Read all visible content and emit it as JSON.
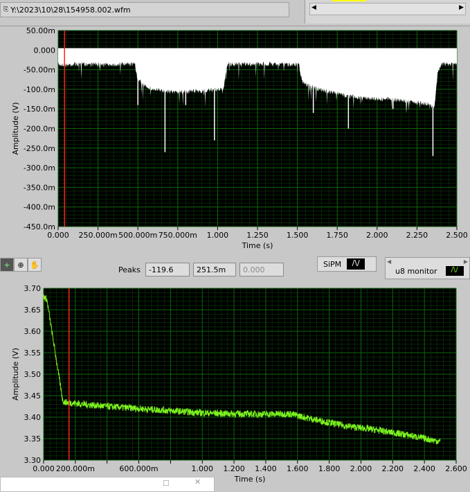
{
  "file_path": "Y:\\2023\\10\\28\\154958.002.wfm",
  "toolbar": {
    "peaks_label": "Peaks",
    "peak_values": [
      "-119.6",
      "251.5m",
      "0.000"
    ],
    "legend_sipm": "SiPM",
    "legend_u8": "u8 monitor"
  },
  "colors": {
    "plot_bg": "#000000",
    "grid": "#0a6a0a",
    "top_trace": "#ffffff",
    "bottom_trace": "#7cf21e",
    "cursor": "#ff2020"
  },
  "chart_data": [
    {
      "type": "area",
      "title": "",
      "xlabel": "Time (s)",
      "ylabel": "Amplitude (V)",
      "xlim": [
        0,
        2.5
      ],
      "ylim": [
        -0.45,
        0.05
      ],
      "xticks": [
        "0.000",
        "250.000m",
        "500.000m",
        "750.000m",
        "1.000",
        "1.250",
        "1.500",
        "1.750",
        "2.000",
        "2.250",
        "2.500"
      ],
      "yticks": [
        "50.00m",
        "0.000",
        "-50.00m",
        "-100.0m",
        "-150.0m",
        "-200.0m",
        "-250.0m",
        "-300.0m",
        "-350.0m",
        "-400.0m",
        "-450.0m"
      ],
      "cursor_x": 0.04,
      "series": [
        {
          "name": "SiPM",
          "fill_to": 0,
          "x": [
            0,
            0.05,
            0.1,
            0.2,
            0.3,
            0.4,
            0.48,
            0.5,
            0.55,
            0.6,
            0.7,
            0.8,
            0.9,
            1.0,
            1.04,
            1.06,
            1.2,
            1.4,
            1.51,
            1.53,
            1.6,
            1.7,
            1.8,
            1.9,
            2.0,
            2.1,
            2.2,
            2.3,
            2.36,
            2.38,
            2.4,
            2.5
          ],
          "y": [
            -0.03,
            -0.032,
            -0.03,
            -0.03,
            -0.031,
            -0.03,
            -0.03,
            -0.07,
            -0.085,
            -0.095,
            -0.1,
            -0.1,
            -0.098,
            -0.095,
            -0.09,
            -0.03,
            -0.03,
            -0.03,
            -0.03,
            -0.075,
            -0.09,
            -0.1,
            -0.11,
            -0.115,
            -0.118,
            -0.12,
            -0.125,
            -0.13,
            -0.14,
            -0.05,
            -0.03,
            -0.03
          ],
          "spikes": [
            [
              0.5,
              -0.14
            ],
            [
              0.67,
              -0.26
            ],
            [
              0.8,
              -0.14
            ],
            [
              0.98,
              -0.23
            ],
            [
              1.6,
              -0.16
            ],
            [
              1.82,
              -0.2
            ],
            [
              2.1,
              -0.15
            ],
            [
              2.35,
              -0.27
            ]
          ]
        }
      ]
    },
    {
      "type": "line",
      "title": "",
      "xlabel": "Time (s)",
      "ylabel": "Amplitude (V)",
      "xlim": [
        0,
        2.6
      ],
      "ylim": [
        3.3,
        3.7
      ],
      "xticks": [
        "0.000",
        "200.000m",
        "",
        "600.000m",
        "",
        "1.000",
        "1.200",
        "1.400",
        "1.600",
        "1.800",
        "2.000",
        "2.200",
        "2.400",
        "2.600"
      ],
      "yticks": [
        "3.70",
        "3.65",
        "3.60",
        "3.55",
        "3.50",
        "3.45",
        "3.40",
        "3.35",
        "3.30"
      ],
      "cursor_x": 0.16,
      "series": [
        {
          "name": "u8 monitor",
          "noise": 0.008,
          "x": [
            0,
            0.02,
            0.12,
            0.13,
            0.2,
            0.4,
            0.6,
            0.8,
            1.0,
            1.2,
            1.4,
            1.55,
            1.7,
            1.9,
            2.1,
            2.3,
            2.5
          ],
          "y": [
            3.68,
            3.675,
            3.44,
            3.435,
            3.432,
            3.425,
            3.42,
            3.415,
            3.41,
            3.408,
            3.407,
            3.408,
            3.395,
            3.38,
            3.37,
            3.358,
            3.343
          ]
        }
      ]
    }
  ]
}
